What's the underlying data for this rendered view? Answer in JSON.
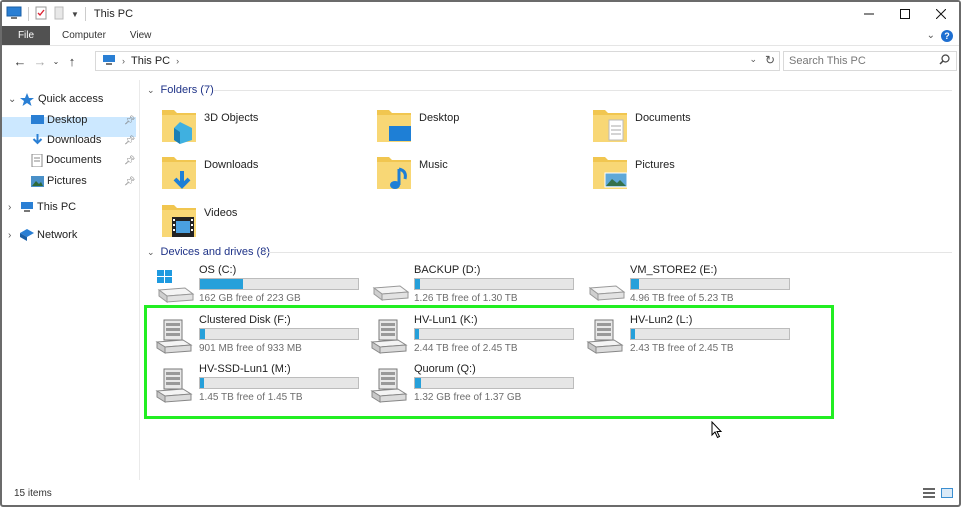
{
  "window": {
    "title": "This PC",
    "controls": [
      "minimize",
      "maximize",
      "close"
    ]
  },
  "ribbon": {
    "tabs": [
      "File",
      "Computer",
      "View"
    ]
  },
  "address": {
    "path": "This PC",
    "search_placeholder": "Search This PC"
  },
  "nav": {
    "quick_access": "Quick access",
    "items": [
      {
        "label": "Desktop",
        "icon": "desktop-icon"
      },
      {
        "label": "Downloads",
        "icon": "downloads-icon"
      },
      {
        "label": "Documents",
        "icon": "documents-icon"
      },
      {
        "label": "Pictures",
        "icon": "pictures-icon"
      }
    ],
    "this_pc": "This PC",
    "network": "Network"
  },
  "folders": {
    "header": "Folders (7)",
    "items": [
      {
        "label": "3D Objects",
        "icon": "3d-objects-folder-icon"
      },
      {
        "label": "Desktop",
        "icon": "desktop-folder-icon"
      },
      {
        "label": "Documents",
        "icon": "documents-folder-icon"
      },
      {
        "label": "Downloads",
        "icon": "downloads-folder-icon"
      },
      {
        "label": "Music",
        "icon": "music-folder-icon"
      },
      {
        "label": "Pictures",
        "icon": "pictures-folder-icon"
      },
      {
        "label": "Videos",
        "icon": "videos-folder-icon"
      }
    ]
  },
  "drives": {
    "header": "Devices and drives (8)",
    "items": [
      {
        "label": "OS (C:)",
        "free": "162 GB free of 223 GB",
        "used_fraction": 0.27,
        "kind": "os"
      },
      {
        "label": "BACKUP (D:)",
        "free": "1.26 TB free of 1.30 TB",
        "used_fraction": 0.03,
        "kind": "local"
      },
      {
        "label": "VM_STORE2 (E:)",
        "free": "4.96 TB free of 5.23 TB",
        "used_fraction": 0.05,
        "kind": "local"
      },
      {
        "label": "Clustered Disk (F:)",
        "free": "901 MB free of 933 MB",
        "used_fraction": 0.03,
        "kind": "server"
      },
      {
        "label": "HV-Lun1 (K:)",
        "free": "2.44 TB free of 2.45 TB",
        "used_fraction": 0.01,
        "kind": "server"
      },
      {
        "label": "HV-Lun2 (L:)",
        "free": "2.43 TB free of 2.45 TB",
        "used_fraction": 0.01,
        "kind": "server"
      },
      {
        "label": "HV-SSD-Lun1 (M:)",
        "free": "1.45 TB free of 1.45 TB",
        "used_fraction": 0.0,
        "kind": "server"
      },
      {
        "label": "Quorum (Q:)",
        "free": "1.32 GB free of 1.37 GB",
        "used_fraction": 0.04,
        "kind": "server"
      }
    ]
  },
  "status": {
    "items": "15 items"
  },
  "colors": {
    "accent": "#26a0da",
    "highlight": "#22ee22",
    "selection": "#cce8ff"
  }
}
